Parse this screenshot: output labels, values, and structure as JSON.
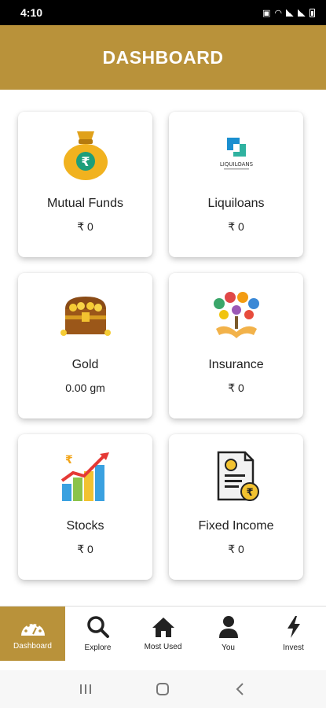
{
  "status_bar": {
    "time": "4:10"
  },
  "header": {
    "title": "DASHBOARD"
  },
  "cards": [
    {
      "title": "Mutual Funds",
      "value": "₹ 0",
      "icon": "money-bag-icon"
    },
    {
      "title": "Liquiloans",
      "value": "₹ 0",
      "icon": "liquiloans-logo",
      "logo_text": "LIQUILOANS"
    },
    {
      "title": "Gold",
      "value": "0.00 gm",
      "icon": "treasure-chest-icon"
    },
    {
      "title": "Insurance",
      "value": "₹ 0",
      "icon": "insurance-tree-icon"
    },
    {
      "title": "Stocks",
      "value": "₹ 0",
      "icon": "stocks-chart-icon"
    },
    {
      "title": "Fixed Income",
      "value": "₹ 0",
      "icon": "certificate-rupee-icon"
    }
  ],
  "bottom_nav": [
    {
      "label": "Dashboard",
      "icon": "speedometer-icon",
      "active": true
    },
    {
      "label": "Explore",
      "icon": "search-icon"
    },
    {
      "label": "Most Used",
      "icon": "home-icon"
    },
    {
      "label": "You",
      "icon": "user-icon"
    },
    {
      "label": "Invest",
      "icon": "lightning-icon"
    }
  ],
  "colors": {
    "accent": "#b9923a",
    "card_bg": "#ffffff",
    "text": "#222222"
  }
}
